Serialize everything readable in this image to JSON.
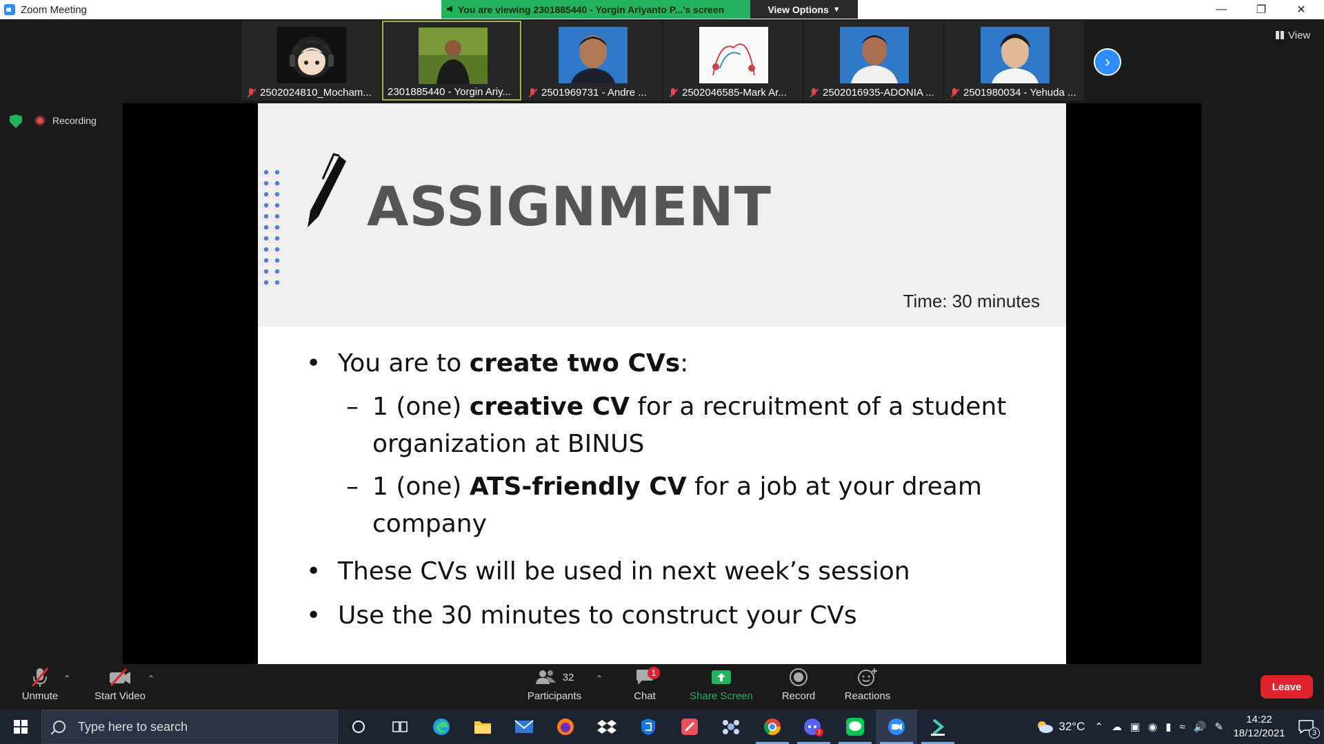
{
  "window": {
    "title": "Zoom Meeting"
  },
  "share_banner": {
    "viewing_text": "You are viewing 2301885440 - Yorgin Ariyanto P...'s screen",
    "options_label": "View Options"
  },
  "participants": [
    {
      "name": "2502024810_Mocham...",
      "icon": "anime-avatar",
      "active": false
    },
    {
      "name": "2301885440 - Yorgin Ariy...",
      "icon": "person-photo",
      "active": true
    },
    {
      "name": "2501969731 - Andre ...",
      "icon": "person-photo",
      "active": false
    },
    {
      "name": "2502046585-Mark Ar...",
      "icon": "sketch-photo",
      "active": false
    },
    {
      "name": "2502016935-ADONIA ...",
      "icon": "person-photo",
      "active": false
    },
    {
      "name": "2501980034 - Yehuda ...",
      "icon": "person-photo",
      "active": false
    }
  ],
  "view_label": "View",
  "recording_label": "Recording",
  "slide": {
    "title": "ASSIGNMENT",
    "time": "Time: 30 minutes",
    "b1_pre": "You are to ",
    "b1_bold": "create two CVs",
    "b1_post": ":",
    "s1_pre": "1 (one) ",
    "s1_bold": "creative CV",
    "s1_post": " for a recruitment of a student organization at BINUS",
    "s2_pre": "1 (one) ",
    "s2_bold": "ATS-friendly CV",
    "s2_post": " for a job at your dream company",
    "b2": "These CVs will be used in next week’s session",
    "b3": "Use the 30 minutes to construct your CVs"
  },
  "toolbar": {
    "unmute": "Unmute",
    "start_video": "Start Video",
    "participants": "Participants",
    "participants_count": "32",
    "chat": "Chat",
    "chat_badge": "1",
    "share_screen": "Share Screen",
    "record": "Record",
    "reactions": "Reactions",
    "leave": "Leave"
  },
  "taskbar": {
    "search_placeholder": "Type here to search",
    "temperature": "32°C",
    "time": "14:22",
    "date": "18/12/2021",
    "notification_count": "3",
    "discord_badge": "7"
  },
  "colors": {
    "zoom_blue": "#2d8cff",
    "share_green": "#23b25d",
    "leave_red": "#e0242e"
  }
}
